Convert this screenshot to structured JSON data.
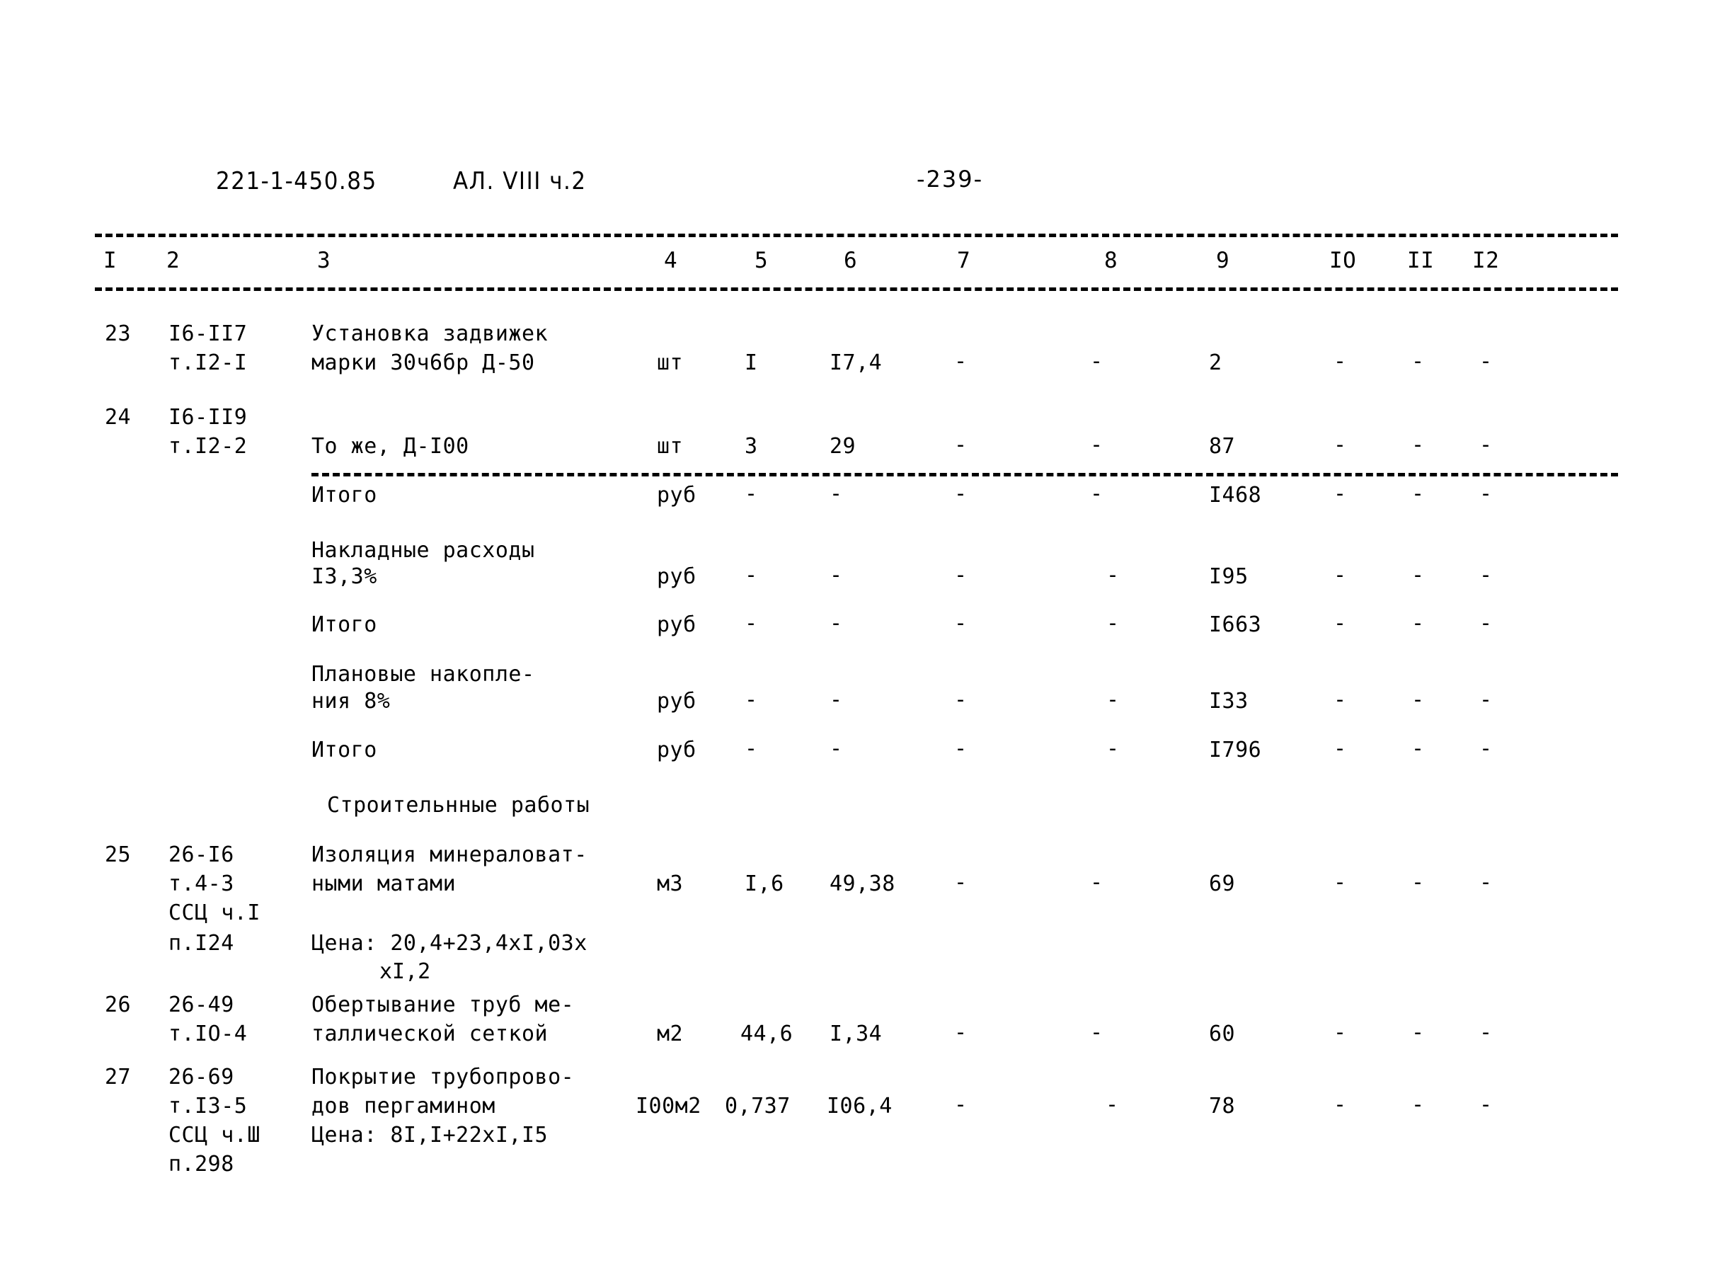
{
  "header": {
    "doc_code": "221-1-450.85",
    "album": "АЛ. VIII ч.2",
    "page_number": "-239-"
  },
  "table": {
    "column_numbers": [
      "I",
      "2",
      "3",
      "4",
      "5",
      "6",
      "7",
      "8",
      "9",
      "IO",
      "II",
      "I2"
    ],
    "empty_mark": "-",
    "rows": [
      {
        "no": "23",
        "code_line1": "I6-II7",
        "code_line2": "т.I2-I",
        "desc_line1": "Установка задвижек",
        "desc_line2": "марки 30ч6бр Д-50",
        "unit": "шт",
        "c5": "I",
        "c6": "I7,4",
        "c7": "-",
        "c8": "-",
        "c9": "2",
        "c10": "-",
        "c11": "-",
        "c12": "-"
      },
      {
        "no": "24",
        "code_line1": "I6-II9",
        "code_line2": "т.I2-2",
        "desc_line1": "То же, Д-I00",
        "unit": "шт",
        "c5": "3",
        "c6": "29",
        "c7": "-",
        "c8": "-",
        "c9": "87",
        "c10": "-",
        "c11": "-",
        "c12": "-"
      }
    ],
    "summary_rows": [
      {
        "label_line1": "Итого",
        "unit": "руб",
        "c5": "-",
        "c6": "-",
        "c7": "-",
        "c8": "-",
        "c9": "I468",
        "c10": "-",
        "c11": "-",
        "c12": "-"
      },
      {
        "label_line1": "Накладные расходы",
        "label_line2": "I3,3%",
        "unit": "руб",
        "c5": "-",
        "c6": "-",
        "c7": "-",
        "c8": "-",
        "c9": "I95",
        "c10": "-",
        "c11": "-",
        "c12": "-"
      },
      {
        "label_line1": "Итого",
        "unit": "руб",
        "c5": "-",
        "c6": "-",
        "c7": "-",
        "c8": "-",
        "c9": "I663",
        "c10": "-",
        "c11": "-",
        "c12": "-"
      },
      {
        "label_line1": "Плановые накопле-",
        "label_line2": "ния 8%",
        "unit": "руб",
        "c5": "-",
        "c6": "-",
        "c7": "-",
        "c8": "-",
        "c9": "I33",
        "c10": "-",
        "c11": "-",
        "c12": "-"
      },
      {
        "label_line1": "Итого",
        "unit": "руб",
        "c5": "-",
        "c6": "-",
        "c7": "-",
        "c8": "-",
        "c9": "I796",
        "c10": "-",
        "c11": "-",
        "c12": "-"
      }
    ],
    "section_caption": "Строительнные работы",
    "rows2": [
      {
        "no": "25",
        "code_line1": "26-I6",
        "code_line2": "т.4-3",
        "code_line3": "ССЦ ч.I",
        "code_line4": "п.I24",
        "desc_line1": "Изоляция минераловат-",
        "desc_line2": "ными матами",
        "price_line1": "Цена: 20,4+23,4xI,03x",
        "price_line2": "xI,2",
        "unit": "м3",
        "c5": "I,6",
        "c6": "49,38",
        "c7": "-",
        "c8": "-",
        "c9": "69",
        "c10": "-",
        "c11": "-",
        "c12": "-"
      },
      {
        "no": "26",
        "code_line1": "26-49",
        "code_line2": "т.IO-4",
        "desc_line1": "Обертывание труб ме-",
        "desc_line2": "таллической сеткой",
        "unit": "м2",
        "c5": "44,6",
        "c6": "I,34",
        "c7": "-",
        "c8": "-",
        "c9": "60",
        "c10": "-",
        "c11": "-",
        "c12": "-"
      },
      {
        "no": "27",
        "code_line1": "26-69",
        "code_line2": "т.I3-5",
        "code_line3": "ССЦ ч.Ш",
        "code_line4": "п.298",
        "desc_line1": "Покрытие трубопрово-",
        "desc_line2": "дов пергамином",
        "price_line1": "Цена: 8I,I+22xI,I5",
        "unit": "I00м2",
        "c5": "0,737",
        "c6": "I06,4",
        "c7": "-",
        "c8": "-",
        "c9": "78",
        "c10": "-",
        "c11": "-",
        "c12": "-"
      }
    ]
  }
}
